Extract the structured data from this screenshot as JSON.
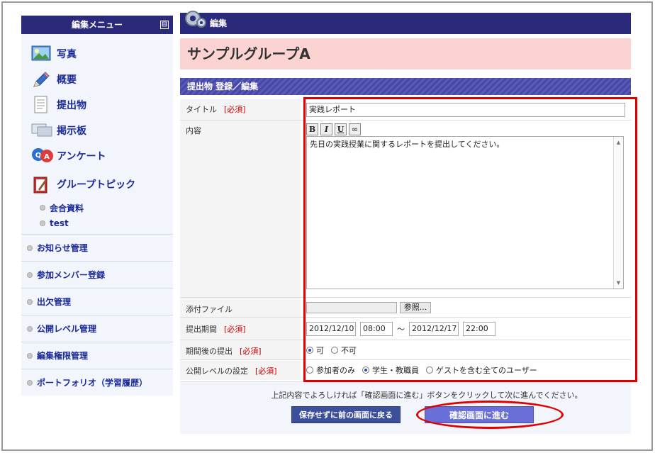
{
  "sidebar": {
    "header": "編集メニュー",
    "toggle": "⊟",
    "items": [
      {
        "label": "写真"
      },
      {
        "label": "概要"
      },
      {
        "label": "提出物"
      },
      {
        "label": "掲示板"
      },
      {
        "label": "アンケート"
      },
      {
        "label": "グループトピック"
      }
    ],
    "subitems": [
      {
        "label": "会合資料"
      },
      {
        "label": "test"
      }
    ],
    "menu": [
      {
        "label": "お知らせ管理"
      },
      {
        "label": "参加メンバー登録"
      },
      {
        "label": "出欠管理"
      },
      {
        "label": "公開レベル管理"
      },
      {
        "label": "編集権限管理"
      },
      {
        "label": "ポートフォリオ（学習履歴）"
      }
    ]
  },
  "main": {
    "header": "編集",
    "group_title": "サンプルグループA",
    "section_title": "提出物 登録／編集"
  },
  "form": {
    "required": "[必須]",
    "title_label": "タイトル",
    "title_value": "実践レポート",
    "content_label": "内容",
    "toolbar": {
      "bold": "B",
      "italic": "I",
      "underline": "U",
      "link": "∞"
    },
    "content_value": "先日の実践授業に関するレポートを提出してください。",
    "attach_label": "添付ファイル",
    "browse_label": "参照...",
    "period_label": "提出期間",
    "start_date": "2012/12/10",
    "start_time": "08:00",
    "tilde": "〜",
    "end_date": "2012/12/17",
    "end_time": "22:00",
    "late_label": "期間後の提出",
    "late_options": [
      "可",
      "不可"
    ],
    "level_label": "公開レベルの設定",
    "level_options": [
      "参加者のみ",
      "学生・教職員",
      "ゲストを含む全てのユーザー"
    ]
  },
  "footer": {
    "note": "上記内容でよろしければ「確認画面に進む」ボタンをクリックして次に進んでください。",
    "back_button": "保存せずに前の画面に戻る",
    "next_button": "確認画面に進む"
  }
}
